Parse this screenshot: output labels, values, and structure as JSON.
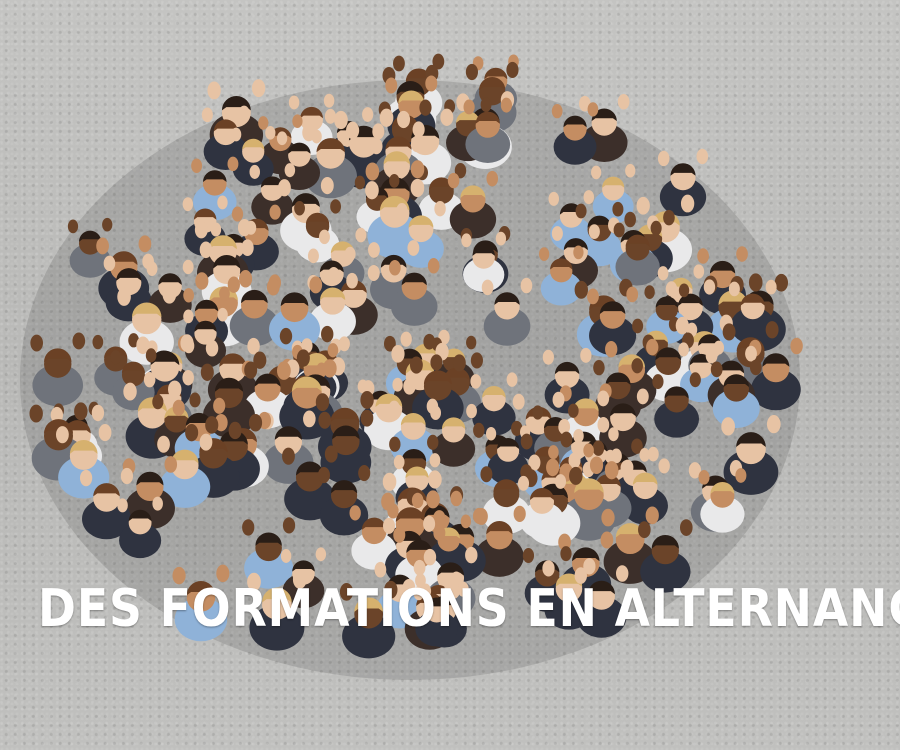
{
  "headline": "DES FORMATIONS EN ALTERNANCE",
  "photo": {
    "subject": "crowd-waving-from-above",
    "colors": {
      "ground": "#bdbdbb",
      "suit_dark": "#2f3340",
      "suit_grey": "#6f737b",
      "shirt_blue": "#8fb2d8",
      "shirt_white": "#e9e9ea",
      "skin_light": "#e7c3a4",
      "skin_mid": "#c48d62",
      "skin_dark": "#6b4429",
      "hair_dark": "#2a1e17",
      "hair_brown": "#6b4125",
      "hair_blond": "#d6b16e",
      "headline_text": "#ffffff"
    }
  }
}
